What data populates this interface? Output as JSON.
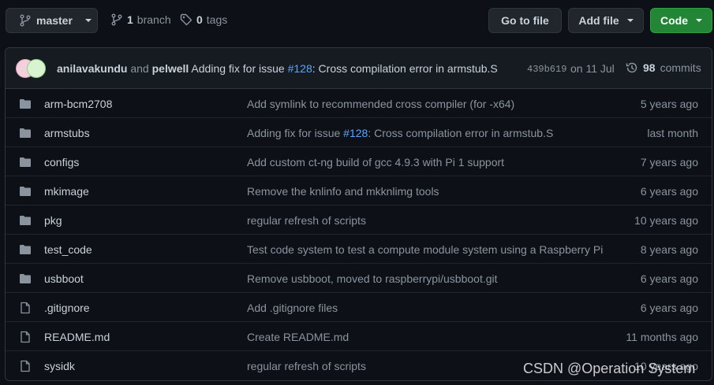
{
  "topbar": {
    "branch_name": "master",
    "branch_count": "1",
    "branch_label": "branch",
    "tag_count": "0",
    "tag_label": "tags",
    "go_to_file": "Go to file",
    "add_file": "Add file",
    "code": "Code"
  },
  "commit": {
    "author1": "anilavakundu",
    "and": "and",
    "author2": "pelwell",
    "message_prefix": "Adding fix for issue",
    "issue": "#128",
    "message_suffix": ": Cross compilation error in armstub.S",
    "sha": "439b619",
    "date": "on 11 Jul",
    "commit_count": "98",
    "commits_label": "commits"
  },
  "files": [
    {
      "type": "folder",
      "name": "arm-bcm2708",
      "message": "Add symlink to recommended cross compiler (for -x64)",
      "age": "5 years ago"
    },
    {
      "type": "folder",
      "name": "armstubs",
      "message_prefix": "Adding fix for issue ",
      "issue": "#128",
      "message_suffix": ": Cross compilation error in armstub.S",
      "age": "last month"
    },
    {
      "type": "folder",
      "name": "configs",
      "message": "Add custom ct-ng build of gcc 4.9.3 with Pi 1 support",
      "age": "7 years ago"
    },
    {
      "type": "folder",
      "name": "mkimage",
      "message": "Remove the knlinfo and mkknlimg tools",
      "age": "6 years ago"
    },
    {
      "type": "folder",
      "name": "pkg",
      "message": "regular refresh of scripts",
      "age": "10 years ago"
    },
    {
      "type": "folder",
      "name": "test_code",
      "message": "Test code system to test a compute module system using a Raspberry Pi",
      "age": "8 years ago"
    },
    {
      "type": "folder",
      "name": "usbboot",
      "message": "Remove usbboot, moved to raspberrypi/usbboot.git",
      "age": "6 years ago"
    },
    {
      "type": "file",
      "name": ".gitignore",
      "message": "Add .gitignore files",
      "age": "6 years ago"
    },
    {
      "type": "file",
      "name": "README.md",
      "message": "Create README.md",
      "age": "11 months ago"
    },
    {
      "type": "file",
      "name": "sysidk",
      "message": "regular refresh of scripts",
      "age": "10 years ago"
    }
  ],
  "watermark": "CSDN @Operation System",
  "colors": {
    "background": "#0d1117",
    "accent_link": "#58a6ff",
    "code_button": "#238636"
  }
}
